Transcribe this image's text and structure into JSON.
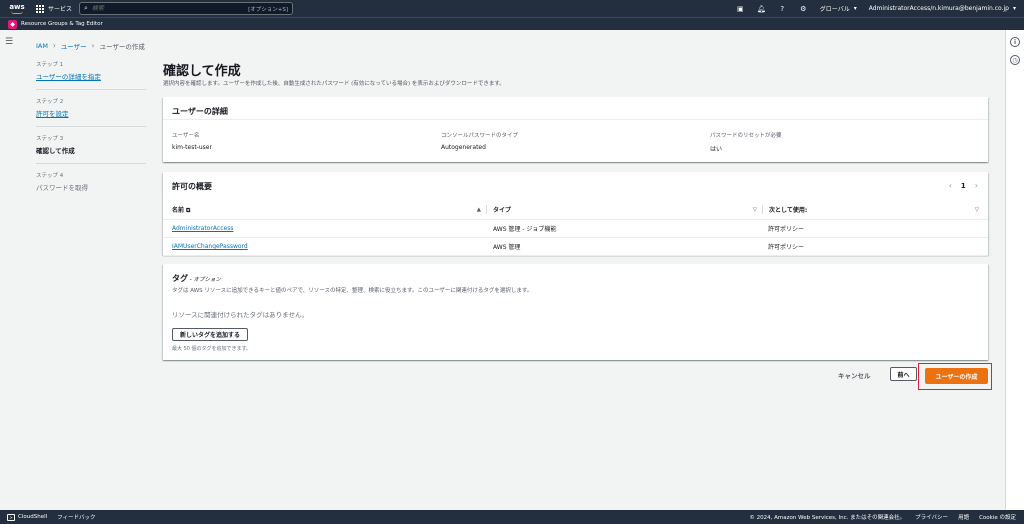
{
  "topnav": {
    "logo_text": "aws",
    "services_label": "サービス",
    "search_placeholder": "検索",
    "search_shortcut": "[オプション+S]",
    "region_label": "グローバル",
    "account_label": "AdministratorAccess/n.kimura@benjamin.co.jp"
  },
  "subbar": {
    "label": "Resource Groups & Tag Editor"
  },
  "breadcrumb": {
    "items": [
      "IAM",
      "ユーザー",
      "ユーザーの作成"
    ]
  },
  "steps": [
    {
      "num": "ステップ 1",
      "name": "ユーザーの詳細を指定"
    },
    {
      "num": "ステップ 2",
      "name": "許可を設定"
    },
    {
      "num": "ステップ 3",
      "name": "確認して作成"
    },
    {
      "num": "ステップ 4",
      "name": "パスワードを取得"
    }
  ],
  "main": {
    "title": "確認して作成",
    "description": "選択内容を確認します。ユーザーを作成した後、自動生成されたパスワード (有効になっている場合) を表示およびダウンロードできます。"
  },
  "details": {
    "header": "ユーザーの詳細",
    "fields": [
      {
        "label": "ユーザー名",
        "value": "kim-test-user"
      },
      {
        "label": "コンソールパスワードのタイプ",
        "value": "Autogenerated"
      },
      {
        "label": "パスワードのリセットが必要",
        "value": "はい"
      }
    ]
  },
  "permissions": {
    "header": "許可の概要",
    "page": "1",
    "columns": [
      "名前",
      "タイプ",
      "次として使用:"
    ],
    "rows": [
      {
        "name": "AdministratorAccess",
        "type": "AWS 管理 - ジョブ機能",
        "used_as": "許可ポリシー"
      },
      {
        "name": "IAMUserChangePassword",
        "type": "AWS 管理",
        "used_as": "許可ポリシー"
      }
    ]
  },
  "tags": {
    "header": "タグ",
    "optional": " - オプション",
    "description": "タグは AWS リソースに追加できるキーと値のペアで、リソースの特定、整理、検索に役立ちます。このユーザーに関連付けるタグを選択します。",
    "empty": "リソースに関連付けられたタグはありません。",
    "add_button": "新しいタグを追加する",
    "limit": "最大 50 個のタグを追加できます。"
  },
  "actions": {
    "cancel": "キャンセル",
    "previous": "前へ",
    "create": "ユーザーの作成"
  },
  "bottombar": {
    "cloudshell": "CloudShell",
    "feedback": "フィードバック",
    "copyright": "© 2024, Amazon Web Services, Inc. またはその関連会社。",
    "privacy": "プライバシー",
    "terms": "用語",
    "cookie": "Cookie の設定"
  },
  "colors": {
    "nav_bg": "#232f3e",
    "link": "#0073bb",
    "primary_button": "#ec7211",
    "highlight_box": "#e0202a",
    "resource_groups_icon": "#e7157b"
  }
}
